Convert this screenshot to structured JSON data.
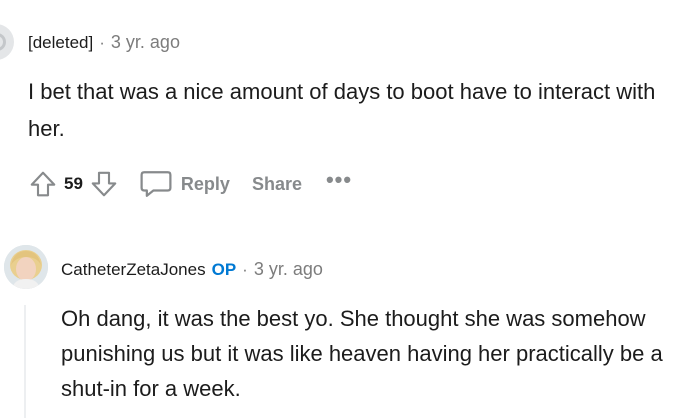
{
  "comments": [
    {
      "author": "[deleted]",
      "separator": "·",
      "timestamp": "3 yr. ago",
      "body": "I bet that was a nice amount of days to boot have to interact with her.",
      "votes": "59",
      "actions": {
        "reply": "Reply",
        "share": "Share",
        "more": "•••"
      }
    },
    {
      "author": "CatheterZetaJones",
      "op_badge": "OP",
      "separator": "·",
      "timestamp": "3 yr. ago",
      "body": "Oh dang, it was the best yo. She thought she was somehow punishing us but it was like heaven having her practically be a shut-in for a week."
    }
  ],
  "icons": {
    "upvote": "upvote-arrow-icon",
    "downvote": "downvote-arrow-icon",
    "reply": "speech-bubble-icon",
    "deleted_avatar": "default-avatar-icon"
  },
  "colors": {
    "text": "#1c1c1c",
    "muted": "#7c7c7c",
    "action": "#878a8c",
    "op": "#0079d3",
    "thread_line": "#edeff1"
  }
}
